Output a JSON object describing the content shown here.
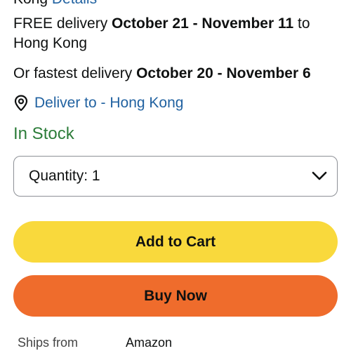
{
  "top_cut": {
    "prefix": "Kong",
    "link": "Details"
  },
  "delivery": {
    "free_prefix": "FREE delivery",
    "free_dates": "October 21 - November 11",
    "free_suffix": "to Hong Kong",
    "fastest_prefix": "Or fastest delivery",
    "fastest_dates": "October 20 - November 6"
  },
  "deliver_to": {
    "icon": "location-pin-icon",
    "label": "Deliver to - Hong Kong"
  },
  "stock_status": "In Stock",
  "quantity": {
    "label": "Quantity:",
    "value": "1"
  },
  "buttons": {
    "add_to_cart": "Add to Cart",
    "buy_now": "Buy Now"
  },
  "ships_from": {
    "label": "Ships from",
    "value": "Amazon"
  },
  "colors": {
    "link": "#2162a1",
    "in_stock": "#2d7d3a",
    "add_to_cart_bg": "#f9d93c",
    "buy_now_bg": "#ef6c2c"
  }
}
